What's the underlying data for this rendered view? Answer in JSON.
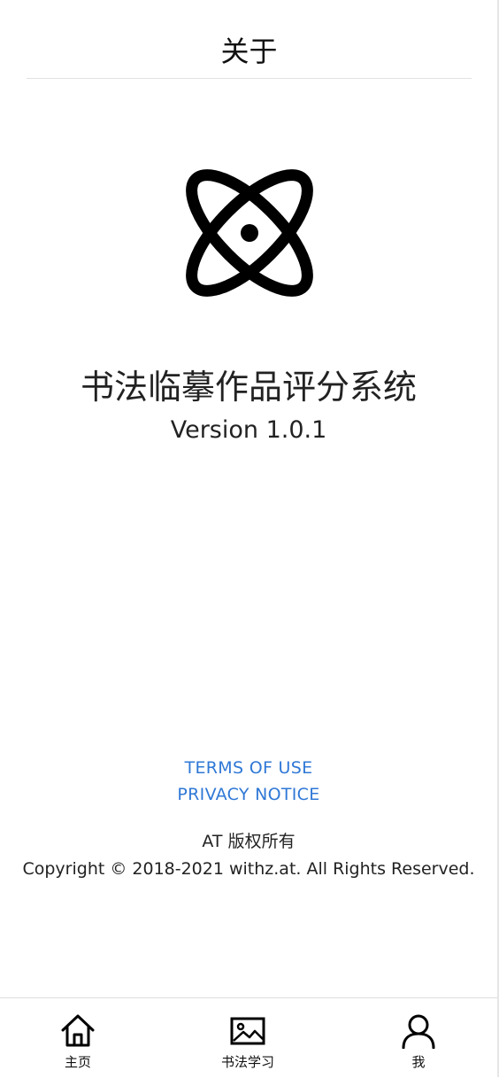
{
  "header": {
    "title": "关于"
  },
  "about": {
    "logo_icon": "atom-icon",
    "app_name": "书法临摹作品评分系统",
    "version": "Version 1.0.1"
  },
  "links": {
    "terms": "TERMS OF USE",
    "privacy": "PRIVACY NOTICE",
    "link_color": "#2f78d6"
  },
  "footer": {
    "rights": "AT 版权所有",
    "copyright": "Copyright © 2018-2021 withz.at. All Rights Reserved."
  },
  "tabbar": {
    "items": [
      {
        "label": "主页",
        "icon": "home-icon"
      },
      {
        "label": "书法学习",
        "icon": "image-icon"
      },
      {
        "label": "我",
        "icon": "user-icon"
      }
    ]
  }
}
